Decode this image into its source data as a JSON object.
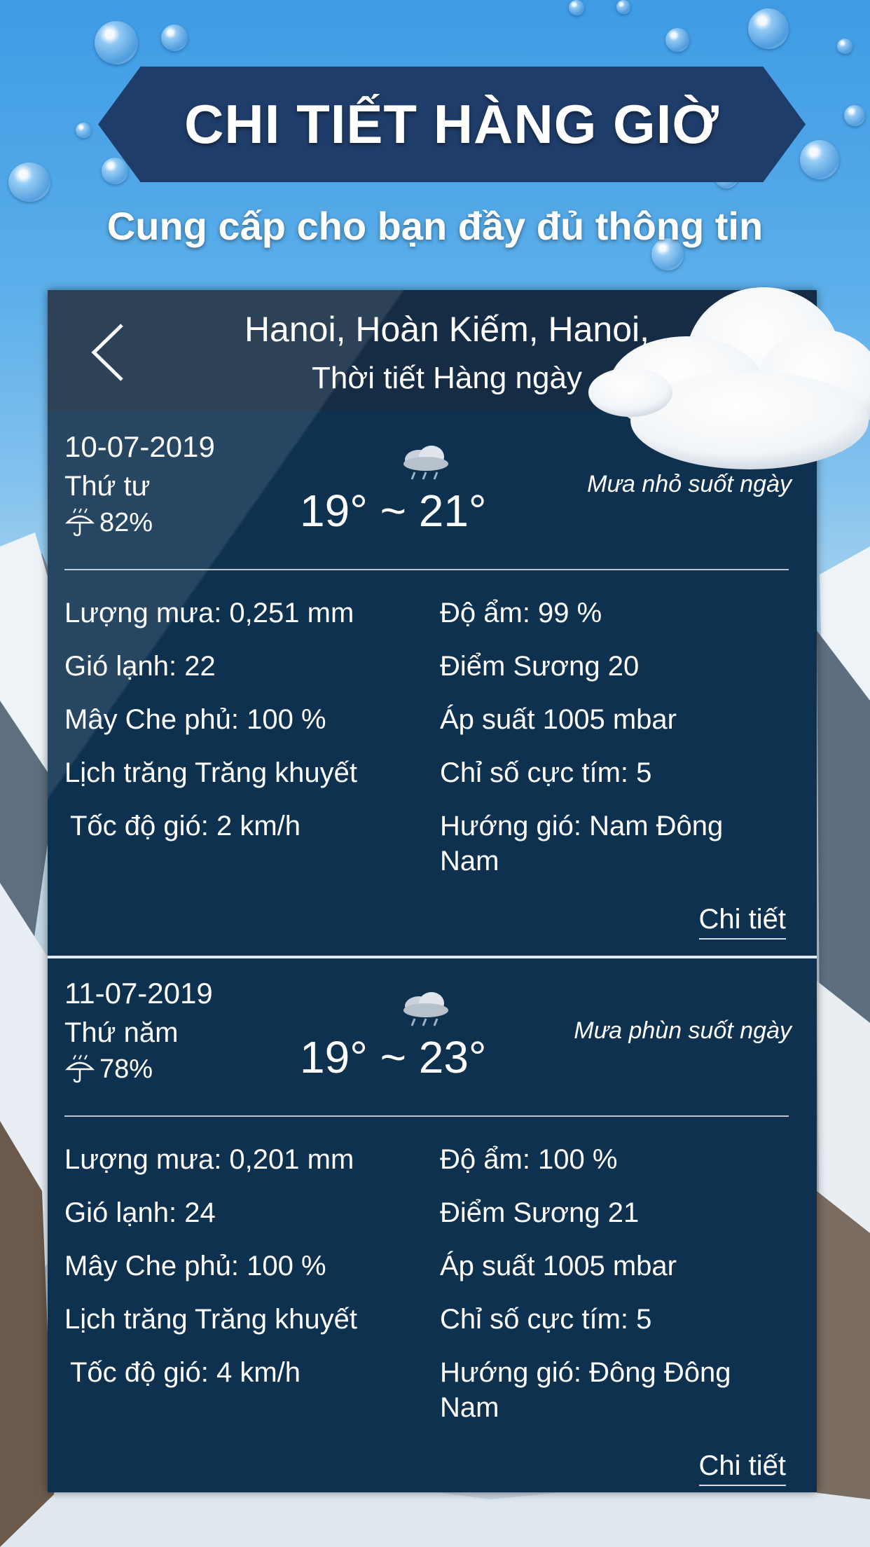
{
  "banner": {
    "title": "CHI TIẾT HÀNG GIỜ",
    "subtitle": "Cung cấp cho bạn đầy đủ thông tin"
  },
  "header": {
    "location": "Hanoi, Hoàn Kiếm, Hanoi,",
    "subtitle": "Thời tiết Hàng ngày"
  },
  "days": [
    {
      "date": "10-07-2019",
      "weekday": "Thứ tư",
      "rain_chance": "82%",
      "condition": "Mưa nhỏ suốt ngày",
      "temp": "19° ~ 21°",
      "rainfall": "Lượng mưa: 0,251 mm",
      "humidity": "Độ ẩm: 99 %",
      "wind_chill": "Gió lạnh: 22",
      "dew_point": "Điểm Sương 20",
      "cloud_cover": "Mây Che phủ: 100 %",
      "pressure": "Áp suất 1005 mbar",
      "moon": "Lịch trăng Trăng khuyết",
      "uv": "Chỉ số cực tím:  5",
      "wind_speed": "Tốc độ gió: 2 km/h",
      "wind_dir_1": "Hướng gió: Nam Đông",
      "wind_dir_2": "Nam",
      "detail_label": "Chi tiết"
    },
    {
      "date": "11-07-2019",
      "weekday": "Thứ năm",
      "rain_chance": "78%",
      "condition": "Mưa phùn suốt ngày",
      "temp": "19° ~ 23°",
      "rainfall": "Lượng mưa: 0,201 mm",
      "humidity": "Độ ẩm: 100 %",
      "wind_chill": "Gió lạnh: 24",
      "dew_point": "Điểm Sương 21",
      "cloud_cover": "Mây Che phủ: 100 %",
      "pressure": "Áp suất 1005 mbar",
      "moon": "Lịch trăng Trăng khuyết",
      "uv": "Chỉ số cực tím:  5",
      "wind_speed": "Tốc độ gió: 4 km/h",
      "wind_dir_1": "Hướng gió: Đông Đông",
      "wind_dir_2": "Nam",
      "detail_label": "Chi tiết"
    }
  ]
}
